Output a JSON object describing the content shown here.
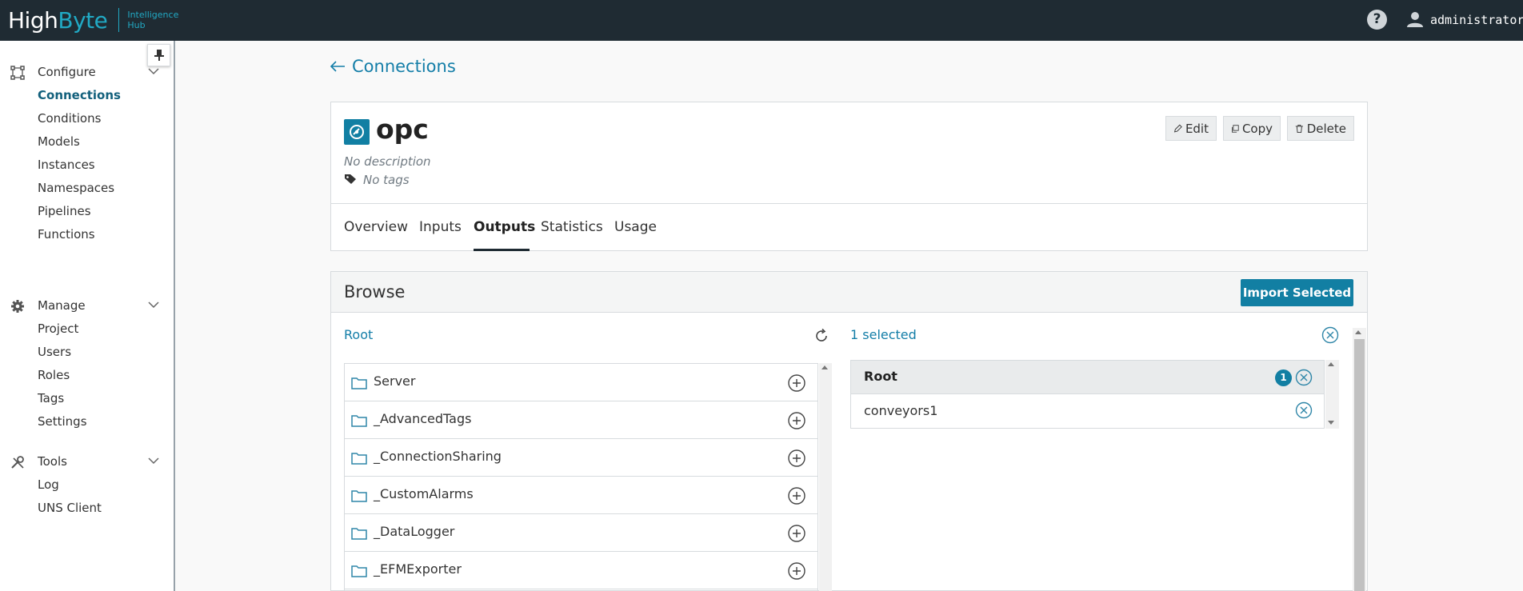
{
  "header": {
    "logo_main_a": "High",
    "logo_main_b": "Byte",
    "logo_sub_line1": "Intelligence",
    "logo_sub_line2": "Hub",
    "help_glyph": "?",
    "user_name": "administrator",
    "brand_color": "#21a9c4"
  },
  "sidebar": {
    "sections": [
      {
        "label": "Configure",
        "icon": "configure-icon",
        "items": [
          "Connections",
          "Conditions",
          "Models",
          "Instances",
          "Namespaces",
          "Pipelines",
          "Functions"
        ]
      },
      {
        "label": "Manage",
        "icon": "gear-icon",
        "items": [
          "Project",
          "Users",
          "Roles",
          "Tags",
          "Settings"
        ]
      },
      {
        "label": "Tools",
        "icon": "tools-icon",
        "items": [
          "Log",
          "UNS Client"
        ]
      }
    ],
    "active_item": "Connections"
  },
  "breadcrumb": {
    "back_label": "Connections"
  },
  "connection": {
    "name": "opc",
    "description": "No description",
    "tags": "No tags",
    "actions": {
      "edit": "Edit",
      "copy": "Copy",
      "delete": "Delete"
    },
    "tabs": [
      "Overview",
      "Inputs",
      "Outputs",
      "Statistics",
      "Usage"
    ],
    "active_tab": "Outputs"
  },
  "browse": {
    "title": "Browse",
    "import_label": "Import Selected",
    "root_label": "Root",
    "tree_items": [
      "Server",
      "_AdvancedTags",
      "_ConnectionSharing",
      "_CustomAlarms",
      "_DataLogger",
      "_EFMExporter"
    ],
    "selected_count_label": "1 selected",
    "selected_group": {
      "label": "Root",
      "count": "1",
      "items": [
        "conveyors1"
      ]
    }
  },
  "colors": {
    "accent": "#127fa3",
    "topbar": "#1f2b33"
  }
}
